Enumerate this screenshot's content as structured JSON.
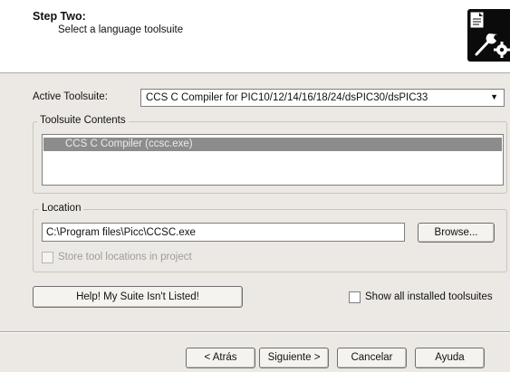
{
  "header": {
    "title": "Step Two:",
    "subtitle": "Select a language toolsuite",
    "icon": "wizard-tools-icon"
  },
  "toolsuite": {
    "label": "Active Toolsuite:",
    "selected": "CCS C Compiler for PIC10/12/14/16/18/24/dsPIC30/dsPIC33"
  },
  "contents": {
    "group_label": "Toolsuite Contents",
    "items": [
      "CCS C Compiler (ccsc.exe)"
    ]
  },
  "location": {
    "group_label": "Location",
    "value": "C:\\Program files\\Picc\\CCSC.exe",
    "browse_label": "Browse...",
    "store_label": "Store tool locations in project",
    "store_checked": false,
    "store_enabled": false
  },
  "help_button_label": "Help!  My Suite Isn't Listed!",
  "show_all_label": "Show all installed toolsuites",
  "show_all_checked": false,
  "footer": {
    "back_label": "< Atrás",
    "next_label": "Siguiente >",
    "cancel_label": "Cancelar",
    "help_label": "Ayuda"
  }
}
